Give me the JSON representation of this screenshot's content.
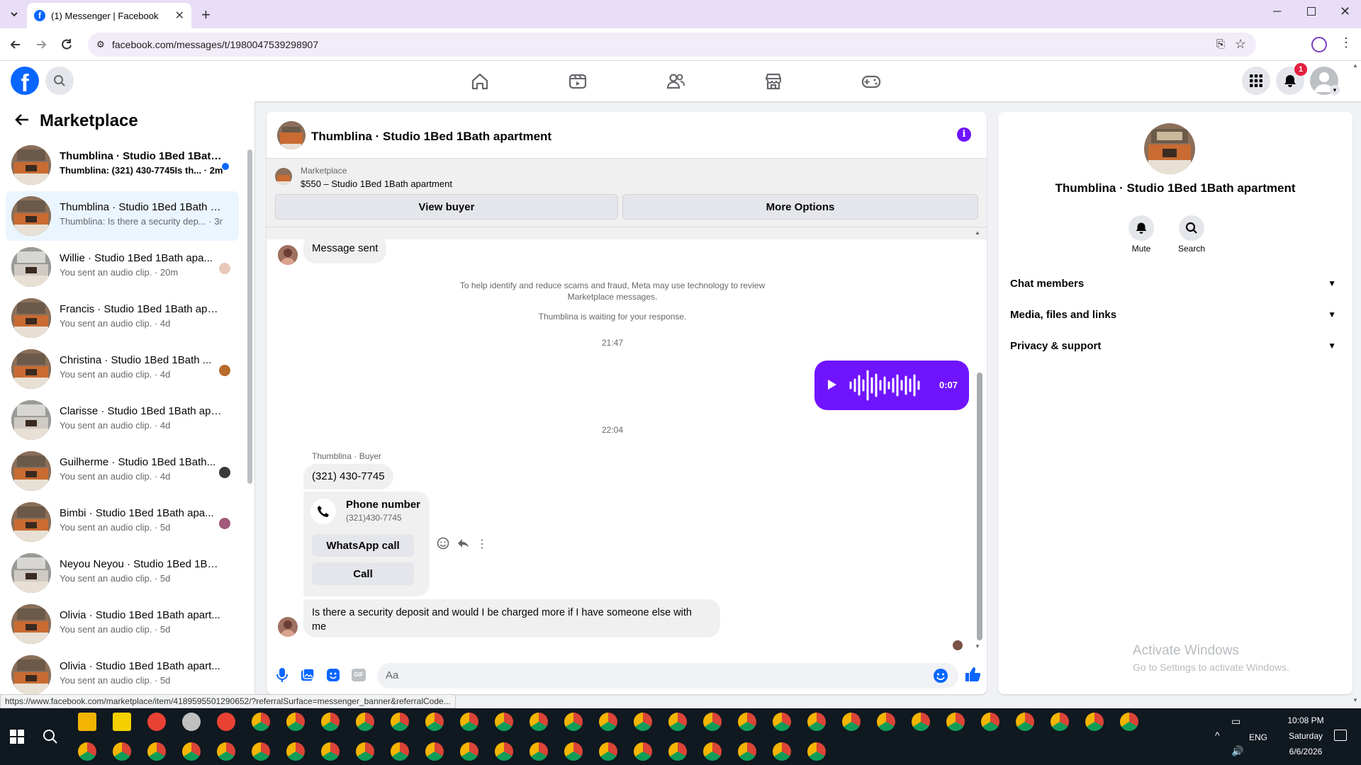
{
  "browser": {
    "tab_title": "(1) Messenger | Facebook",
    "url": "facebook.com/messages/t/1980047539298907",
    "status_url": "https://www.facebook.com/marketplace/item/4189595501290652/?referralSurface=messenger_banner&referralCode..."
  },
  "header": {
    "notification_count": "1"
  },
  "sidebar": {
    "title": "Marketplace",
    "conversations": [
      {
        "name": "Thumblina · Studio 1Bed 1Bath...",
        "preview": "Thumblina: (321) 430-7745Is th...",
        "time": "2m",
        "unread": true,
        "active": false
      },
      {
        "name": "Thumblina · Studio 1Bed 1Bath a...",
        "preview": "Thumblina: Is there a security dep...",
        "time": "3m",
        "unread": false,
        "active": true
      },
      {
        "name": "Willie · Studio 1Bed 1Bath apa...",
        "preview": "You sent an audio clip.",
        "time": "20m",
        "unread": false,
        "active": false
      },
      {
        "name": "Francis · Studio 1Bed 1Bath apart...",
        "preview": "You sent an audio clip.",
        "time": "4d",
        "unread": false,
        "active": false
      },
      {
        "name": "Christina · Studio 1Bed 1Bath ...",
        "preview": "You sent an audio clip.",
        "time": "4d",
        "unread": false,
        "active": false
      },
      {
        "name": "Clarisse · Studio 1Bed 1Bath apar...",
        "preview": "You sent an audio clip.",
        "time": "4d",
        "unread": false,
        "active": false
      },
      {
        "name": "Guilherme · Studio 1Bed 1Bath...",
        "preview": "You sent an audio clip.",
        "time": "4d",
        "unread": false,
        "active": false
      },
      {
        "name": "Bimbi · Studio 1Bed 1Bath apa...",
        "preview": "You sent an audio clip.",
        "time": "5d",
        "unread": false,
        "active": false
      },
      {
        "name": "Neyou Neyou · Studio 1Bed 1Bat...",
        "preview": "You sent an audio clip.",
        "time": "5d",
        "unread": false,
        "active": false
      },
      {
        "name": "Olivia · Studio 1Bed 1Bath apart...",
        "preview": "You sent an audio clip.",
        "time": "5d",
        "unread": false,
        "active": false
      },
      {
        "name": "Olivia · Studio 1Bed 1Bath apart...",
        "preview": "You sent an audio clip.",
        "time": "5d",
        "unread": false,
        "active": false
      }
    ]
  },
  "chat": {
    "title": "Thumblina · Studio 1Bed 1Bath apartment",
    "banner_label": "Marketplace",
    "banner_listing": "$550 – Studio 1Bed 1Bath apartment",
    "view_buyer": "View buyer",
    "more_options": "More Options",
    "msg_sent": "Message sent",
    "notice_line1": "To help identify and reduce scams and fraud, Meta may use technology to review",
    "notice_line2": "Marketplace messages.",
    "waiting": "Thumblina is waiting for your response.",
    "time1": "21:47",
    "audio_duration": "0:07",
    "time2": "22:04",
    "sender_label": "Thumblina · Buyer",
    "phone_msg": "(321) 430-7745",
    "phone_card_title": "Phone number",
    "phone_card_number": "(321)430-7745",
    "whatsapp_call": "WhatsApp call",
    "call": "Call",
    "last_msg_line1": "Is there a security deposit and  would I  be charged more if I have someone else with",
    "last_msg_line2": "me",
    "composer_placeholder": "Aa"
  },
  "info": {
    "title": "Thumblina · Studio 1Bed 1Bath apartment",
    "mute": "Mute",
    "search": "Search",
    "sections": [
      "Chat members",
      "Media, files and links",
      "Privacy & support"
    ],
    "watermark1": "Activate Windows",
    "watermark2": "Go to Settings to activate Windows."
  },
  "taskbar": {
    "time": "10:08 PM",
    "day": "Saturday",
    "date": "6/6/2026",
    "lang": "ENG"
  },
  "colors": {
    "fb_blue": "#0866ff",
    "messenger_purple": "#7014ff",
    "active_row": "#ebf5ff"
  }
}
